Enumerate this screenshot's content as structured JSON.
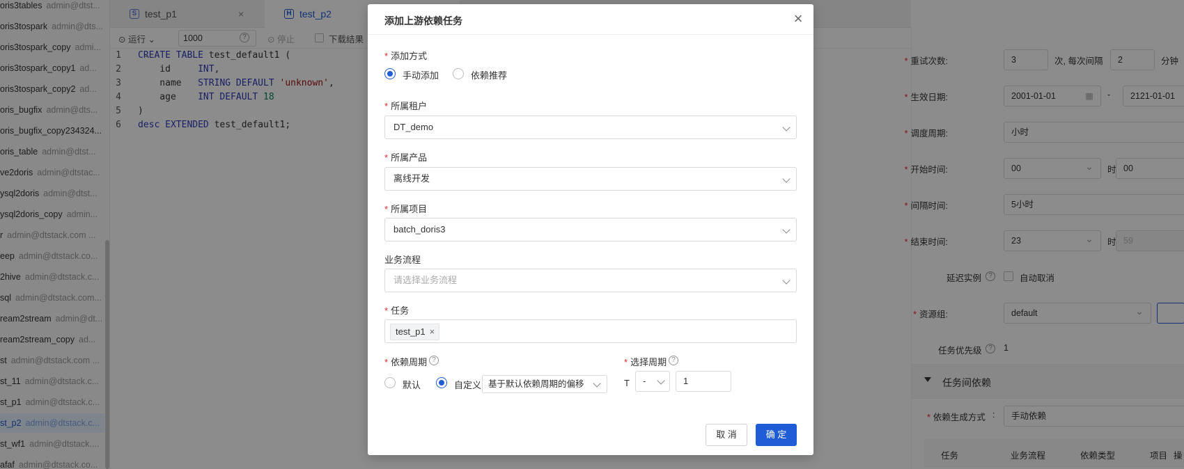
{
  "sidebar": {
    "items": [
      {
        "name": "oris3tables",
        "sub": "admin@dtst..."
      },
      {
        "name": "oris3tospark",
        "sub": "admin@dts..."
      },
      {
        "name": "oris3tospark_copy",
        "sub": "admi..."
      },
      {
        "name": "oris3tospark_copy1",
        "sub": "ad..."
      },
      {
        "name": "oris3tospark_copy2",
        "sub": "ad..."
      },
      {
        "name": "oris_bugfix",
        "sub": "admin@dts..."
      },
      {
        "name": "oris_bugfix_copy234324...",
        "sub": ""
      },
      {
        "name": "oris_table",
        "sub": "admin@dtst..."
      },
      {
        "name": "ve2doris",
        "sub": "admin@dtstac..."
      },
      {
        "name": "ysql2doris",
        "sub": "admin@dtst..."
      },
      {
        "name": "ysql2doris_copy",
        "sub": "admin..."
      },
      {
        "name": "r",
        "sub": "admin@dtstack.com ..."
      },
      {
        "name": "eep",
        "sub": "admin@dtstack.co..."
      },
      {
        "name": "2hive",
        "sub": "admin@dtstack.c..."
      },
      {
        "name": "sql",
        "sub": "admin@dtstack.com..."
      },
      {
        "name": "ream2stream",
        "sub": "admin@dt..."
      },
      {
        "name": "ream2stream_copy",
        "sub": "ad..."
      },
      {
        "name": "st",
        "sub": "admin@dtstack.com ..."
      },
      {
        "name": "st_11",
        "sub": "admin@dtstack.c..."
      },
      {
        "name": "st_p1",
        "sub": "admin@dtstack.c..."
      },
      {
        "name": "st_p2",
        "sub": "admin@dtstack.c..."
      },
      {
        "name": "st_wf1",
        "sub": "admin@dtstack...."
      },
      {
        "name": "afaf",
        "sub": "admin@dtstack.co..."
      }
    ]
  },
  "tabs": {
    "tab1_label": "test_p1",
    "tab1_icon": "S",
    "tab1_close": "×",
    "tab2_label": "test_p2",
    "tab2_icon": "H"
  },
  "toolbar": {
    "run_label": "运行",
    "limit_value": "1000",
    "help": "?",
    "stop_label": "停止",
    "download_label": "下载结果"
  },
  "editor": {
    "lines": [
      {
        "no": "1"
      },
      {
        "no": "2"
      },
      {
        "no": "3"
      },
      {
        "no": "4"
      },
      {
        "no": "5"
      },
      {
        "no": "6"
      }
    ]
  },
  "right_panel": {
    "retry_label": "重试次数:",
    "retry_value": "3",
    "retry_unit": "次, 每次间隔",
    "interval_value": "2",
    "interval_unit": "分钟",
    "effective_label": "生效日期:",
    "effective_start": "2001-01-01",
    "effective_dash": "-",
    "effective_end": "2121-01-01",
    "cycle_label": "调度周期:",
    "cycle_value": "小时",
    "start_label": "开始时间:",
    "start_hour": "00",
    "start_unit": "时",
    "start_min": "00",
    "gap_label": "间隔时间:",
    "gap_value": "5小时",
    "end_label": "结束时间:",
    "end_hour": "23",
    "end_unit": "时",
    "end_min": "59",
    "delay_label": "延迟实例",
    "auto_cancel_label": "自动取消",
    "resource_label": "资源组:",
    "resource_value": "default",
    "priority_label": "任务优先级",
    "priority_value": "1",
    "section_title": "任务间依赖",
    "dep_gen_label": "依赖生成方式",
    "dep_gen_value": "手动依赖",
    "table_headers": [
      "任务",
      "业务流程",
      "依赖类型",
      "项目",
      "操"
    ]
  },
  "modal": {
    "title": "添加上游依赖任务",
    "close": "×",
    "add_method_label": "添加方式",
    "add_manual": "手动添加",
    "add_recommend": "依赖推荐",
    "tenant_label": "所属租户",
    "tenant_value": "DT_demo",
    "product_label": "所属产品",
    "product_value": "离线开发",
    "project_label": "所属项目",
    "project_value": "batch_doris3",
    "flow_label": "业务流程",
    "flow_placeholder": "请选择业务流程",
    "task_label": "任务",
    "task_tag": "test_p1",
    "task_tag_close": "×",
    "dep_cycle_label": "依赖周期",
    "dep_default": "默认",
    "dep_custom": "自定义",
    "dep_custom_select": "基于默认依赖周期的偏移",
    "choose_cycle_label": "选择周期",
    "t_label": "T",
    "sign_value": "-",
    "offset_value": "1",
    "cancel_label": "取 消",
    "ok_label": "确 定"
  }
}
